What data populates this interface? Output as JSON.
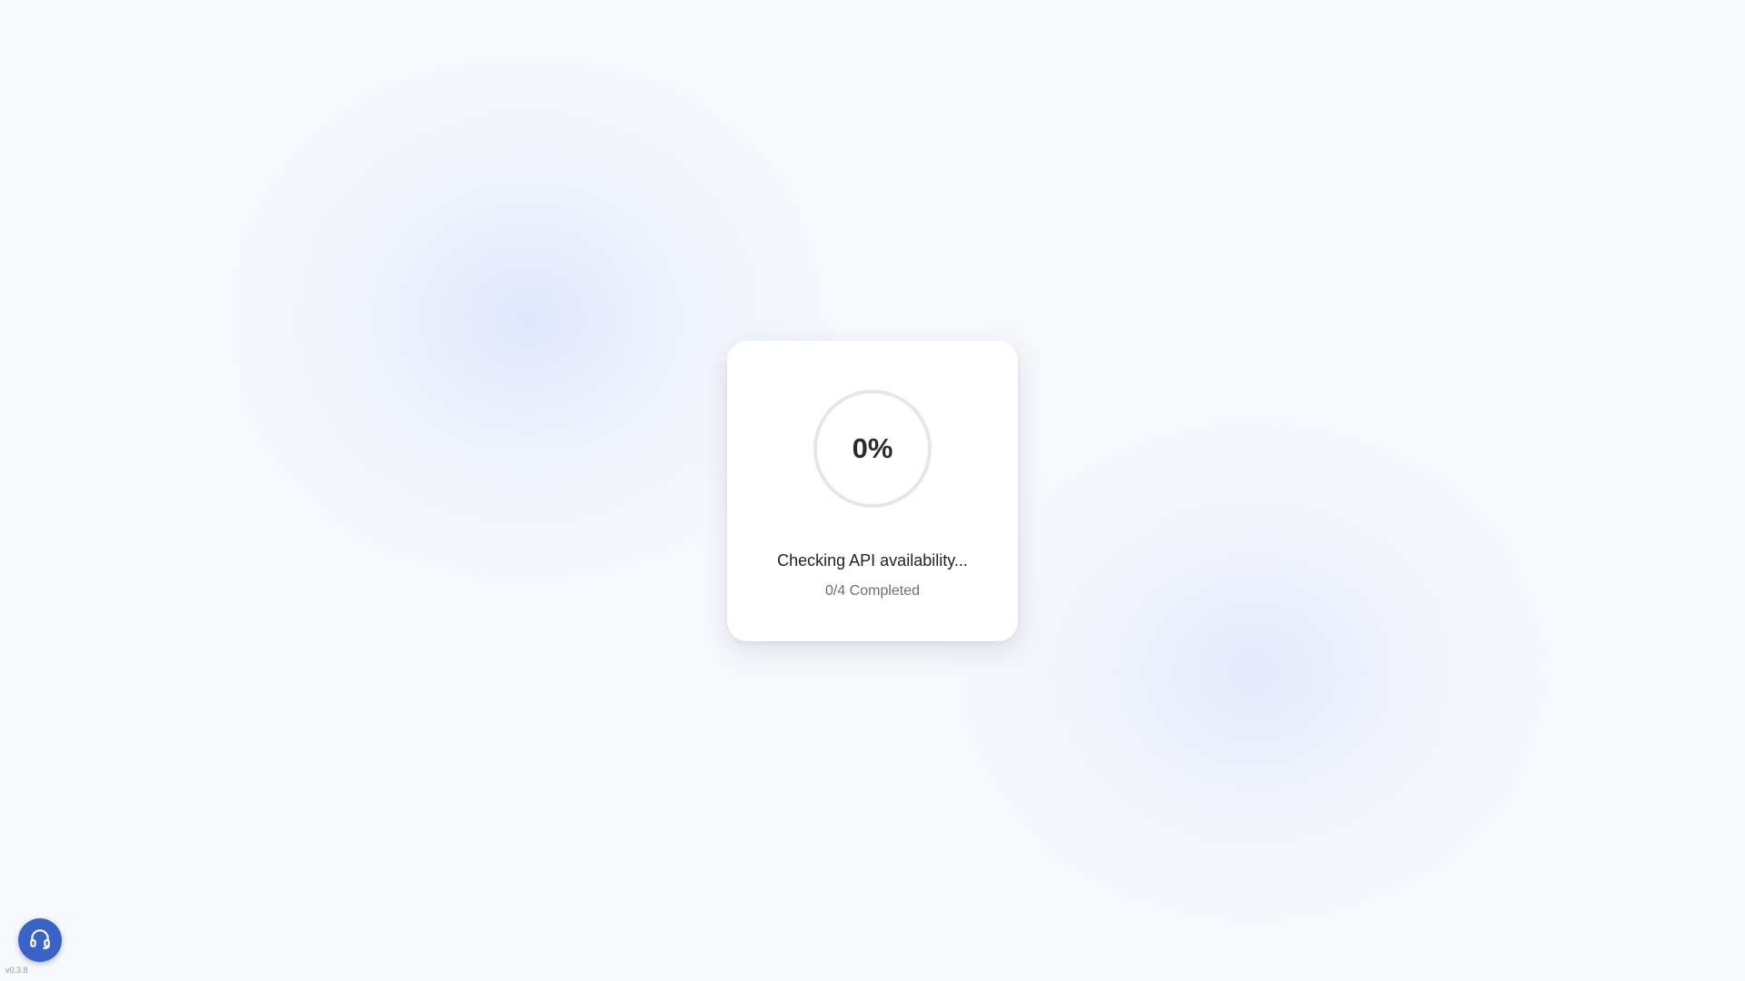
{
  "loader": {
    "percent_label": "0%",
    "progress_fraction": 0,
    "status_text": "Checking API availability...",
    "progress_text": "0/4 Completed"
  },
  "support": {
    "icon": "headset-icon"
  },
  "footer": {
    "version": "v0.3.8"
  },
  "colors": {
    "ring_track": "#e6e6e6",
    "ring_fill": "#3a63c7",
    "support_button": "#3a63c7",
    "background": "#f6f8fc"
  }
}
